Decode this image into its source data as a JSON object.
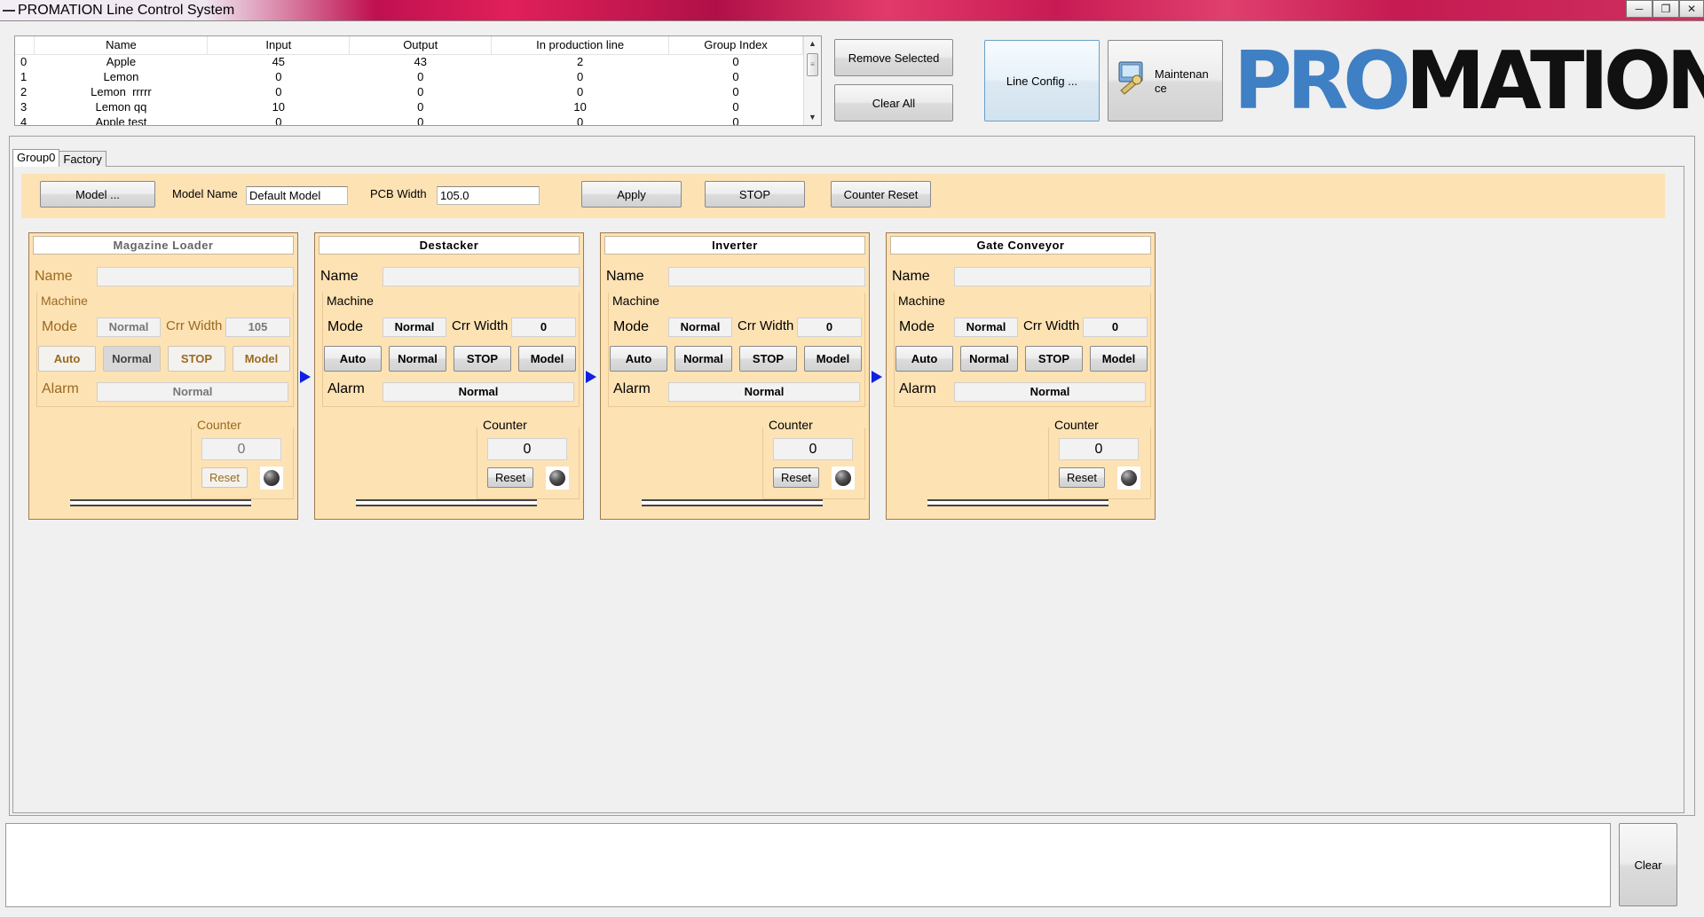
{
  "window": {
    "title": "PROMATION Line Control System",
    "controls": [
      "minimize-icon",
      "restore-icon",
      "close-icon"
    ]
  },
  "models_table": {
    "columns": [
      "",
      "Name",
      "Input",
      "Output",
      "In production line",
      "Group Index"
    ],
    "rows": [
      [
        "0",
        "Apple",
        "45",
        "43",
        "2",
        "0"
      ],
      [
        "1",
        "Lemon",
        "0",
        "0",
        "0",
        "0"
      ],
      [
        "2",
        "Lemon  rrrrr",
        "0",
        "0",
        "0",
        "0"
      ],
      [
        "3",
        "Lemon qq",
        "10",
        "0",
        "10",
        "0"
      ],
      [
        "4",
        "Apple test",
        "0",
        "0",
        "0",
        "0"
      ]
    ]
  },
  "top_buttons": {
    "remove_selected": "Remove Selected",
    "clear_all": "Clear All",
    "line_config": "Line Config ...",
    "maintenance": "Maintenan\nce"
  },
  "logo": {
    "pro": "PRO",
    "mation": "MATION"
  },
  "tabs": [
    "Group0",
    "Factory"
  ],
  "toolbar": {
    "model_button": "Model ...",
    "model_name_label": "Model Name",
    "model_name_value": "Default Model",
    "pcb_width_label": "PCB Width",
    "pcb_width_value": "105.0",
    "apply": "Apply",
    "stop": "STOP",
    "counter_reset": "Counter Reset"
  },
  "stations": [
    {
      "title": "Magazine Loader",
      "name_label": "Name",
      "name_value": "",
      "machine_label": "Machine",
      "mode_label": "Mode",
      "mode_value": "Normal",
      "crr_width_label": "Crr Width",
      "crr_width_value": "105",
      "buttons": [
        "Auto",
        "Normal",
        "STOP",
        "Model"
      ],
      "alarm_label": "Alarm",
      "alarm_value": "Normal",
      "counter_label": "Counter",
      "counter_value": "0",
      "reset_label": "Reset",
      "disabled": true
    },
    {
      "title": "Destacker",
      "name_label": "Name",
      "name_value": "",
      "machine_label": "Machine",
      "mode_label": "Mode",
      "mode_value": "Normal",
      "crr_width_label": "Crr Width",
      "crr_width_value": "0",
      "buttons": [
        "Auto",
        "Normal",
        "STOP",
        "Model"
      ],
      "alarm_label": "Alarm",
      "alarm_value": "Normal",
      "counter_label": "Counter",
      "counter_value": "0",
      "reset_label": "Reset",
      "disabled": false
    },
    {
      "title": "Inverter",
      "name_label": "Name",
      "name_value": "",
      "machine_label": "Machine",
      "mode_label": "Mode",
      "mode_value": "Normal",
      "crr_width_label": "Crr Width",
      "crr_width_value": "0",
      "buttons": [
        "Auto",
        "Normal",
        "STOP",
        "Model"
      ],
      "alarm_label": "Alarm",
      "alarm_value": "Normal",
      "counter_label": "Counter",
      "counter_value": "0",
      "reset_label": "Reset",
      "disabled": false
    },
    {
      "title": "Gate Conveyor",
      "name_label": "Name",
      "name_value": "",
      "machine_label": "Machine",
      "mode_label": "Mode",
      "mode_value": "Normal",
      "crr_width_label": "Crr Width",
      "crr_width_value": "0",
      "buttons": [
        "Auto",
        "Normal",
        "STOP",
        "Model"
      ],
      "alarm_label": "Alarm",
      "alarm_value": "Normal",
      "counter_label": "Counter",
      "counter_value": "0",
      "reset_label": "Reset",
      "disabled": false
    }
  ],
  "log": {
    "text": "",
    "clear": "Clear"
  },
  "colors": {
    "station_bg": "#fde2b4",
    "arrow": "#1020e0",
    "logo_blue": "#3f7fc3",
    "title_gradient": "#c01050"
  }
}
